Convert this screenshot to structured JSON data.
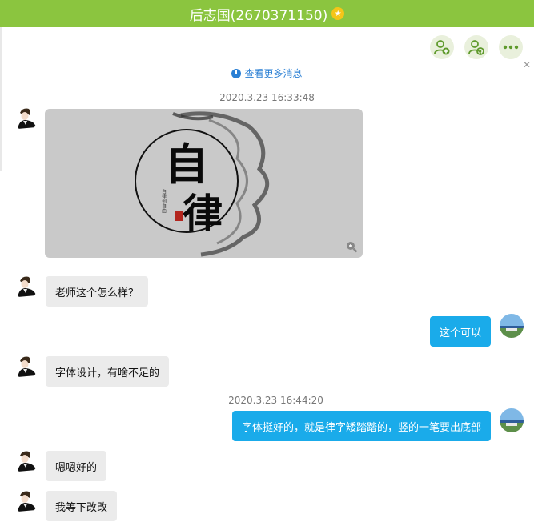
{
  "header": {
    "title": "后志国(2670371150)",
    "badge_icon": "star-badge-icon"
  },
  "toolbar": {
    "icons": [
      "add-contact-icon",
      "contact-settings-icon",
      "more-icon"
    ]
  },
  "history": {
    "more_label": "查看更多消息"
  },
  "messages": [
    {
      "kind": "timestamp",
      "text": "2020.3.23 16:33:48"
    },
    {
      "kind": "image",
      "side": "left",
      "image_text": {
        "char1": "自",
        "char2": "律",
        "small": "自律到自由"
      }
    },
    {
      "kind": "text",
      "side": "left",
      "text": "老师这个怎么样？"
    },
    {
      "kind": "text",
      "side": "right",
      "text": "这个可以"
    },
    {
      "kind": "text",
      "side": "left",
      "text": "字体设计，有啥不足的"
    },
    {
      "kind": "timestamp",
      "text": "2020.3.23 16:44:20"
    },
    {
      "kind": "text",
      "side": "right",
      "text": "字体挺好的，就是律字矮踏踏的，竖的一笔要出底部"
    },
    {
      "kind": "text",
      "side": "left",
      "text": "嗯嗯好的"
    },
    {
      "kind": "text",
      "side": "left",
      "text": "我等下改改"
    }
  ],
  "colors": {
    "title_bar": "#8bc53f",
    "own_bubble": "#1aabea",
    "other_bubble": "#ebebeb",
    "link": "#2a7fd4"
  }
}
